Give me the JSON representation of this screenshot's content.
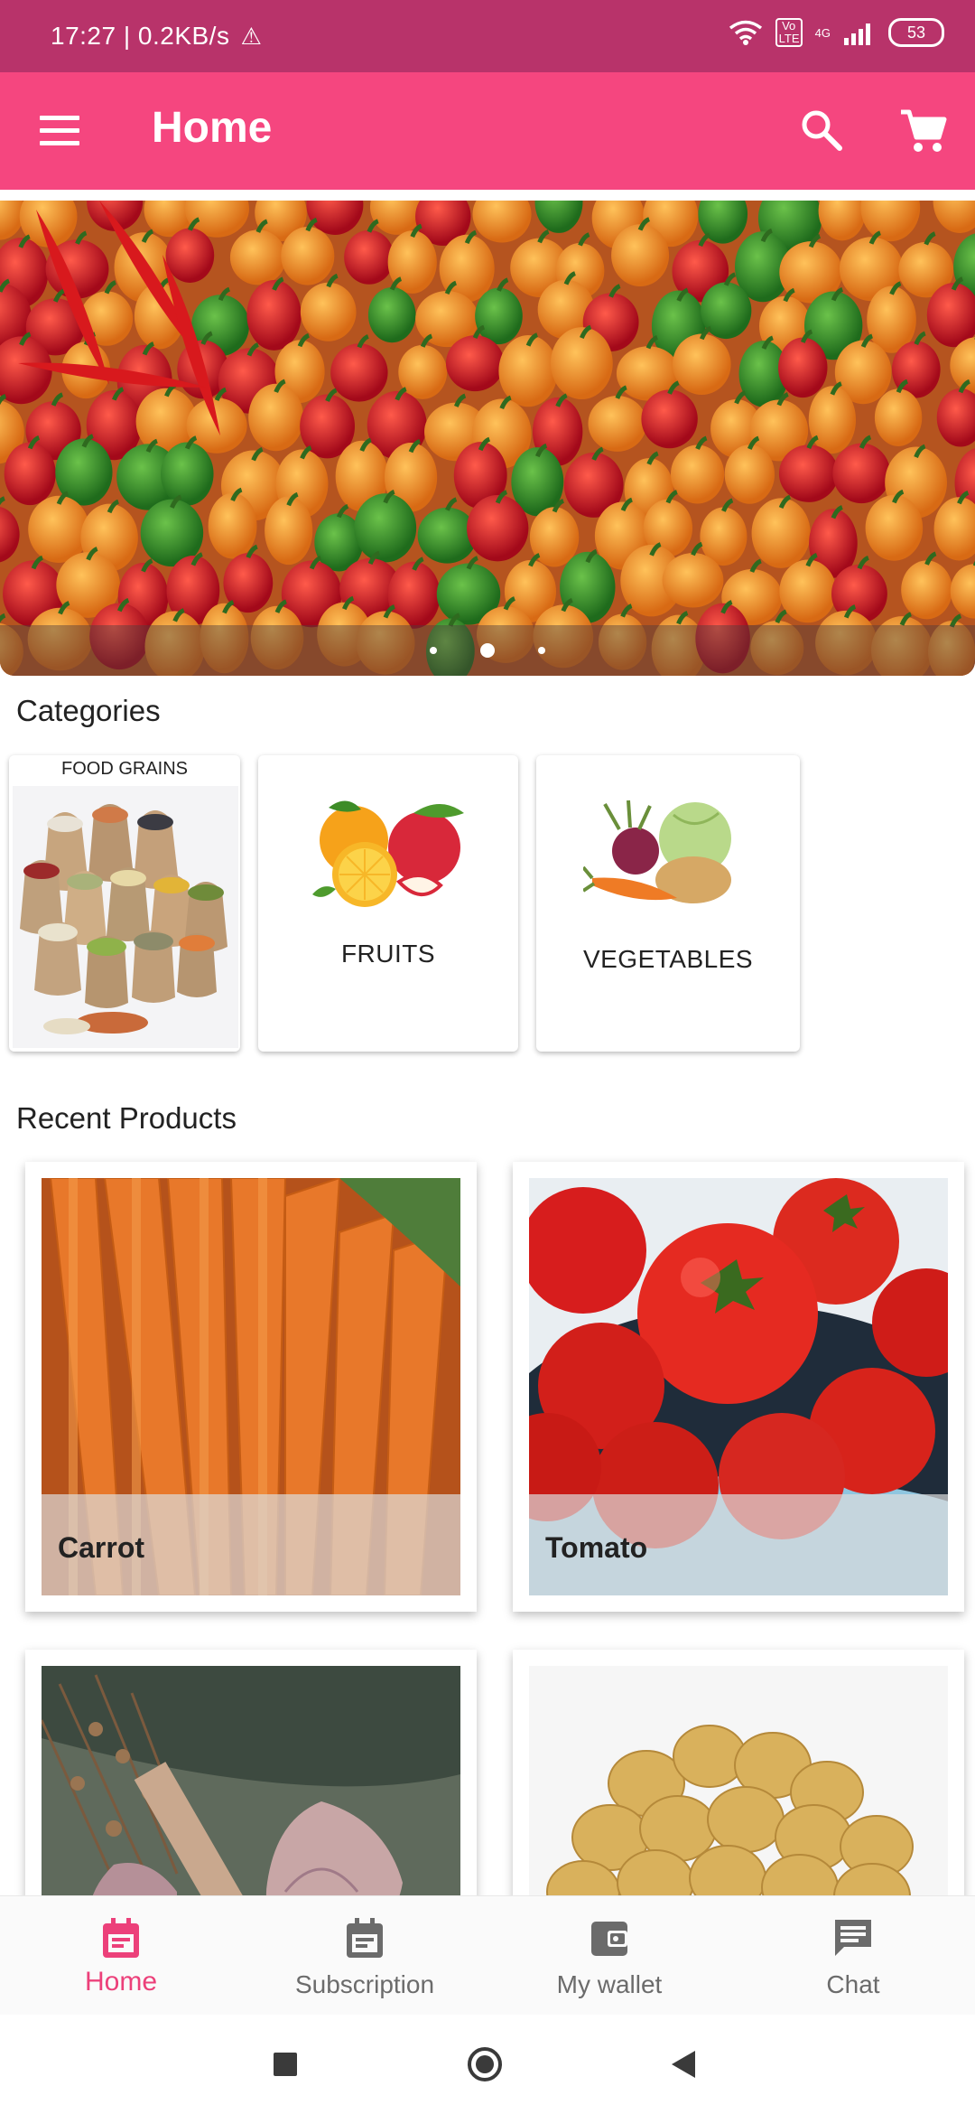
{
  "status_bar": {
    "time_speed": "17:27 | 0.2KB/s",
    "warning_icon": "warning-icon",
    "network_label": "4G",
    "volte_label": "Vo LTE",
    "battery": "53"
  },
  "app_bar": {
    "title": "Home",
    "menu_icon": "menu-icon",
    "search_icon": "search-icon",
    "cart_icon": "cart-icon",
    "background": "#f5467f"
  },
  "banner": {
    "image": "chili-peppers",
    "dots": 3,
    "active_dot": 2
  },
  "categories": {
    "title": "Categories",
    "items": [
      {
        "label": "FOOD GRAINS",
        "image": "grain-sacks"
      },
      {
        "label": "FRUITS",
        "image": "fruits"
      },
      {
        "label": "VEGETABLES",
        "image": "vegetables"
      }
    ]
  },
  "recent_products": {
    "title": "Recent Products",
    "items": [
      {
        "name": "Carrot",
        "image": "carrots"
      },
      {
        "name": "Tomato",
        "image": "tomatoes"
      },
      {
        "name": "",
        "image": "onions-garlic"
      },
      {
        "name": "",
        "image": "potatoes"
      }
    ]
  },
  "bottom_nav": {
    "items": [
      {
        "label": "Home",
        "icon": "calendar-icon",
        "active": true
      },
      {
        "label": "Subscription",
        "icon": "calendar-icon"
      },
      {
        "label": "My wallet",
        "icon": "wallet-icon"
      },
      {
        "label": "Chat",
        "icon": "chat-icon"
      }
    ],
    "active_color": "#ec407a",
    "inactive_color": "#6b6b6b"
  },
  "colors": {
    "status_bar": "#b8336a",
    "app_bar": "#f5467f"
  }
}
